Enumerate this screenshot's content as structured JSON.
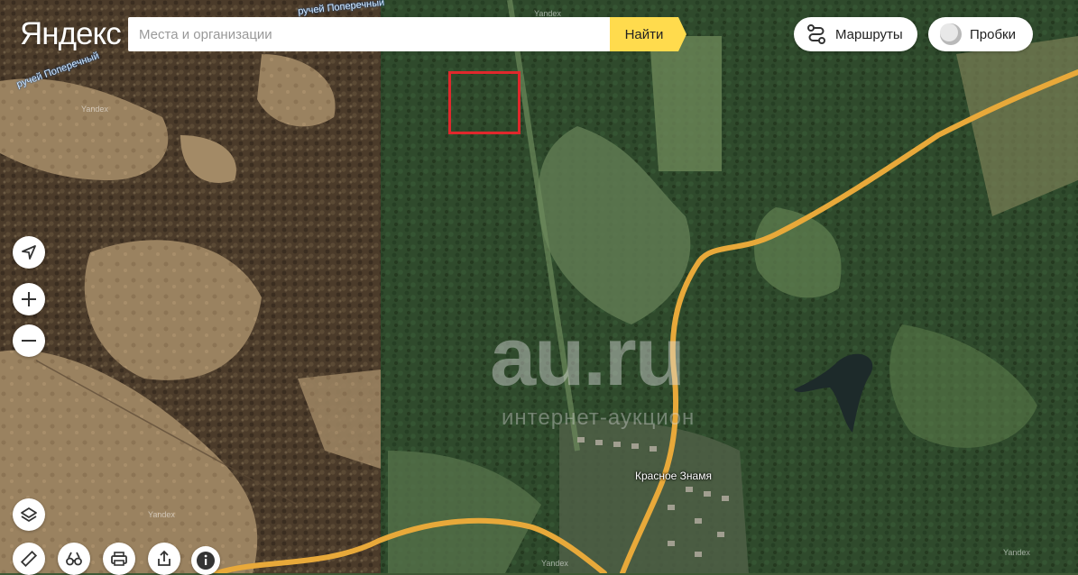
{
  "header": {
    "logo": "Яндекс",
    "search": {
      "placeholder": "Места и организации",
      "value": ""
    },
    "find_label": "Найти",
    "routes_label": "Маршруты",
    "traffic_label": "Пробки"
  },
  "map": {
    "labels": {
      "stream_top": "ручей Поперечный",
      "stream_left": "ручей Поперечный",
      "village": "Красное Знамя",
      "yandex_mark": "Yandex"
    },
    "watermark": {
      "brand": "au.ru",
      "tagline": "интернет-аукцион"
    },
    "colors": {
      "road": "#e8a93a",
      "marker": "#e0282c",
      "search_button": "#ffdb4d"
    }
  },
  "controls": {
    "left": [
      "navigation-arrow-icon",
      "zoom-in-icon",
      "zoom-out-icon",
      "layers-icon"
    ],
    "bottom": [
      "ruler-icon",
      "binoculars-icon",
      "print-icon",
      "share-icon",
      "info-icon"
    ]
  }
}
